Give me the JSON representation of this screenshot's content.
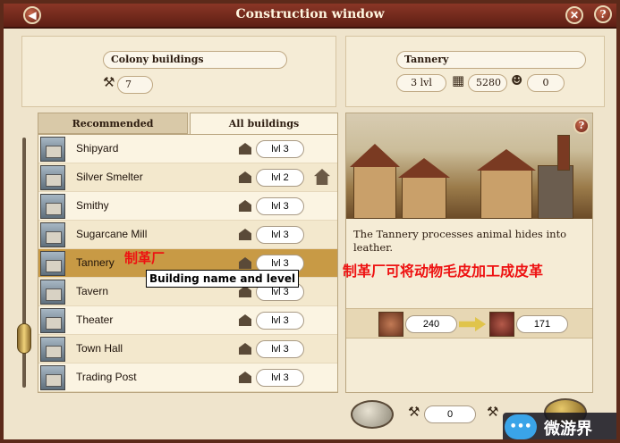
{
  "window": {
    "title": "Construction window"
  },
  "header": {
    "left_label": "Colony buildings",
    "left_count": "7",
    "right_label": "Tannery",
    "right_level": "3 lvl",
    "right_cost": "5280",
    "right_workers": "0"
  },
  "tabs": {
    "recommended": "Recommended",
    "all": "All buildings"
  },
  "buildings": [
    {
      "name": "Shipyard",
      "level": "lvl 3"
    },
    {
      "name": "Silver Smelter",
      "level": "lvl 2"
    },
    {
      "name": "Smithy",
      "level": "lvl 3"
    },
    {
      "name": "Sugarcane Mill",
      "level": "lvl 3"
    },
    {
      "name": "Tannery",
      "level": "lvl 3"
    },
    {
      "name": "Tavern",
      "level": "lvl 3"
    },
    {
      "name": "Theater",
      "level": "lvl 3"
    },
    {
      "name": "Town Hall",
      "level": "lvl 3"
    },
    {
      "name": "Trading Post",
      "level": "lvl 3"
    }
  ],
  "annotations": {
    "row": "制革厂",
    "tooltip": "Building name and level",
    "description": "制革厂可将动物毛皮加工成皮革"
  },
  "detail": {
    "description": "The Tannery processes animal hides into leather.",
    "input_amount": "240",
    "output_amount": "171"
  },
  "bottom": {
    "cost_a": "0"
  },
  "watermark": {
    "text": "微游界"
  },
  "icons": {
    "back": "back-icon",
    "close": "close-icon",
    "help": "help-icon",
    "hammer": "hammer-icon",
    "house": "house-icon",
    "upgrade": "upgrade-icon",
    "hides": "hides-icon",
    "leather": "leather-icon",
    "arrow": "arrow-icon"
  }
}
